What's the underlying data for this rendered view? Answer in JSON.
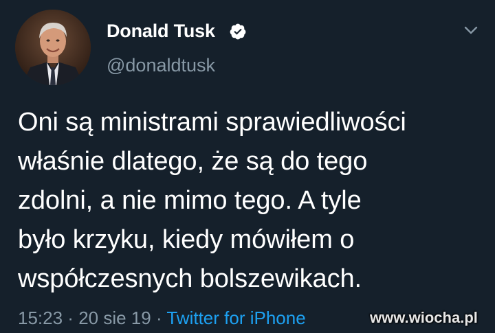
{
  "author": {
    "display_name": "Donald Tusk",
    "handle": "@donaldtusk",
    "verified": true,
    "avatar_icon": "profile-photo",
    "verified_icon": "verified-badge-icon"
  },
  "menu": {
    "icon": "chevron-down-icon"
  },
  "tweet": {
    "text": "Oni są ministrami sprawiedliwości\nwłaśnie dlatego, że są do tego\nzdolni, a nie mimo tego. A tyle\nbyło krzyku, kiedy mówiłem o\nwspółczesnych bolszewikach."
  },
  "meta": {
    "time": "15:23",
    "separator": " · ",
    "date": "20 sie 19",
    "source": "Twitter for iPhone"
  },
  "watermark": {
    "text": "www.wiocha.pl"
  },
  "colors": {
    "background": "#15202b",
    "primary_text": "#ffffff",
    "secondary_text": "#8899a6",
    "link": "#1da1f2"
  }
}
